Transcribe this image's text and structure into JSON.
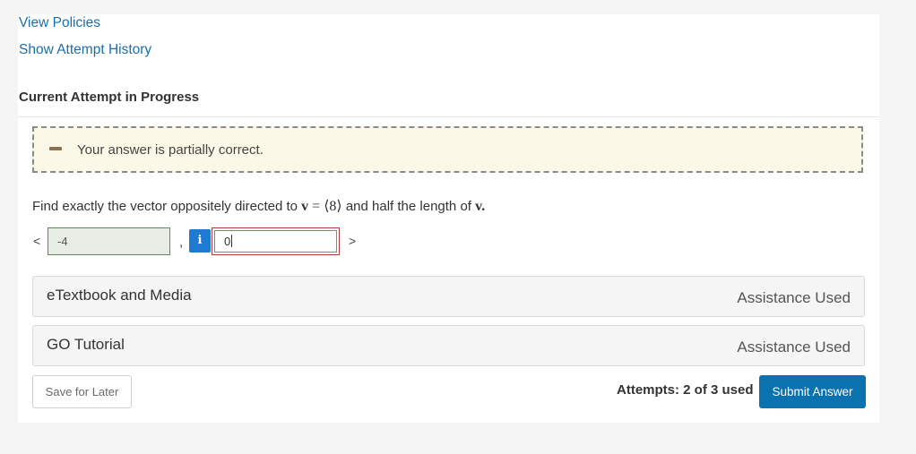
{
  "links": {
    "view_policies": "View Policies",
    "show_attempt_history": "Show Attempt History"
  },
  "attempt": {
    "title": "Current Attempt in Progress"
  },
  "feedback": {
    "icon": "partial-dash-icon",
    "text": "Your answer is partially correct."
  },
  "question": {
    "prefix": "Find exactly the vector oppositely directed to ",
    "vector_symbol": "v",
    "equals": " = ",
    "vector_value": "⟨8⟩",
    "suffix": " and half the length of ",
    "vector_symbol_end": "v",
    "period": "."
  },
  "answer": {
    "open_bracket": "<",
    "close_bracket": ">",
    "comma": ",",
    "component1_value": "-4",
    "info_icon_glyph": "i",
    "component2_value": "0"
  },
  "resources": [
    {
      "title": "eTextbook and Media",
      "status": "Assistance Used"
    },
    {
      "title": "GO Tutorial",
      "status": "Assistance Used"
    }
  ],
  "footer": {
    "save_label": "Save for Later",
    "attempts_text": "Attempts: 2 of 3 used",
    "submit_label": "Submit Answer"
  },
  "colors": {
    "link": "#1a6fa8",
    "submit_bg": "#0b72b0",
    "feedback_bg": "#fcf8e7",
    "correct_border": "#5b8c5a",
    "incorrect_border": "#b03a3a",
    "info_button": "#1f7ad1"
  }
}
